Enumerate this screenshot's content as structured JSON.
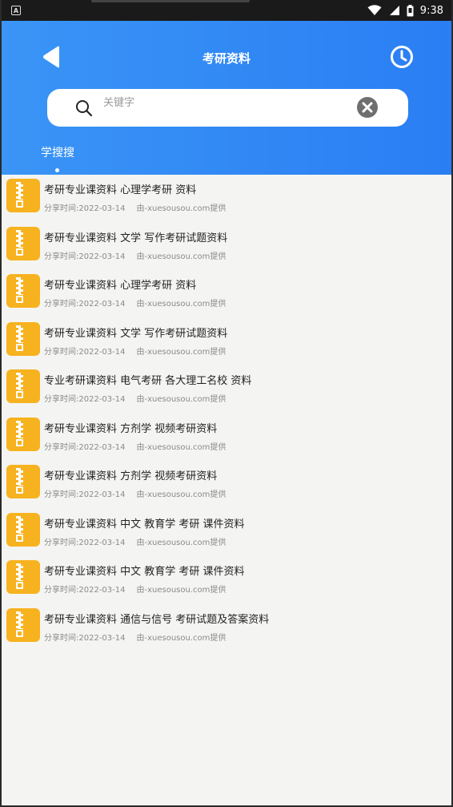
{
  "statusbar": {
    "notification_icon": "A",
    "time": "9:38",
    "icons": [
      "wifi-icon",
      "signal-icon",
      "battery-icon"
    ]
  },
  "header": {
    "title": "考研资料",
    "back_icon": "back-arrow-icon",
    "history_icon": "clock-icon",
    "search": {
      "placeholder": "关键字",
      "value": ""
    },
    "tabs": [
      {
        "label": "学搜搜",
        "active": true
      }
    ],
    "colors": {
      "gradient_start": "#3a95f6",
      "gradient_end": "#2a7ef3"
    }
  },
  "list": {
    "items": [
      {
        "title": "考研专业课资料 心理学考研 资料",
        "date_label": "分享时间:",
        "date": "2022-03-14",
        "source": "由-xuesousou.com提供"
      },
      {
        "title": "考研专业课资料 文学 写作考研试题资料",
        "date_label": "分享时间:",
        "date": "2022-03-14",
        "source": "由-xuesousou.com提供"
      },
      {
        "title": "考研专业课资料 心理学考研 资料",
        "date_label": "分享时间:",
        "date": "2022-03-14",
        "source": "由-xuesousou.com提供"
      },
      {
        "title": "考研专业课资料 文学 写作考研试题资料",
        "date_label": "分享时间:",
        "date": "2022-03-14",
        "source": "由-xuesousou.com提供"
      },
      {
        "title": "专业考研课资料 电气考研 各大理工名校 资料",
        "date_label": "分享时间:",
        "date": "2022-03-14",
        "source": "由-xuesousou.com提供"
      },
      {
        "title": "考研专业课资料 方剂学 视频考研资料",
        "date_label": "分享时间:",
        "date": "2022-03-14",
        "source": "由-xuesousou.com提供"
      },
      {
        "title": "考研专业课资料 方剂学 视频考研资料",
        "date_label": "分享时间:",
        "date": "2022-03-14",
        "source": "由-xuesousou.com提供"
      },
      {
        "title": "考研专业课资料 中文 教育学 考研 课件资料",
        "date_label": "分享时间:",
        "date": "2022-03-14",
        "source": "由-xuesousou.com提供"
      },
      {
        "title": "考研专业课资料 中文 教育学 考研 课件资料",
        "date_label": "分享时间:",
        "date": "2022-03-14",
        "source": "由-xuesousou.com提供"
      },
      {
        "title": "考研专业课资料 通信与信号 考研试题及答案资料",
        "date_label": "分享时间:",
        "date": "2022-03-14",
        "source": "由-xuesousou.com提供"
      }
    ],
    "item_icon": "zip-file-icon",
    "icon_color": "#f7b21f"
  }
}
